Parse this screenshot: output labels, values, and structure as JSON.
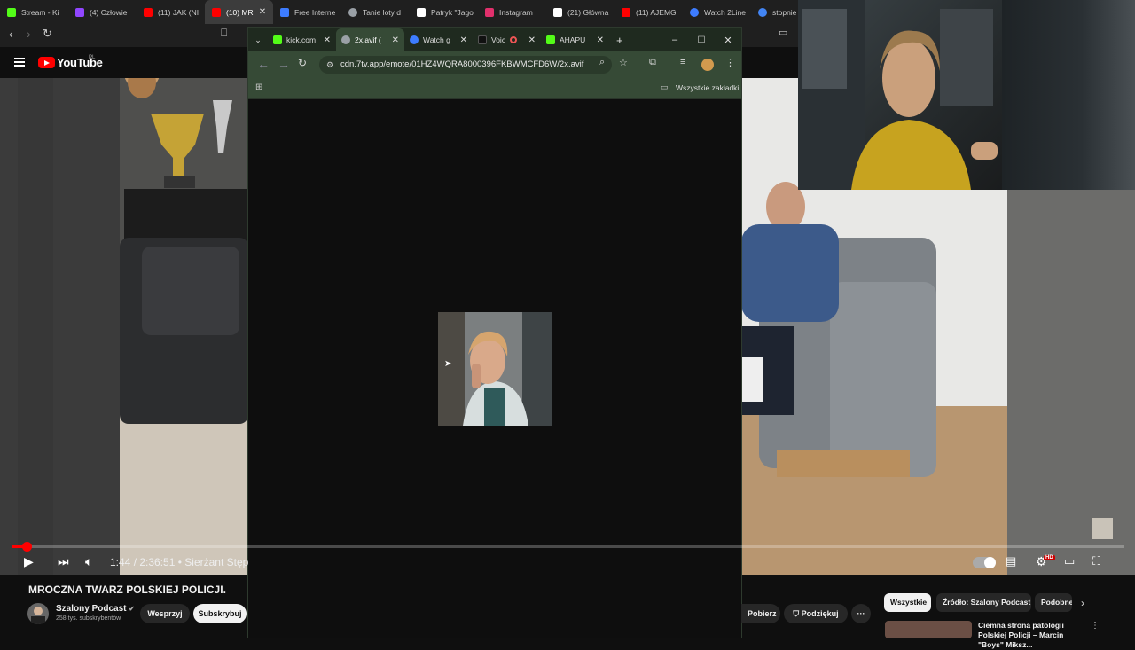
{
  "outer_tabs": [
    {
      "label": "Stream - Ki",
      "color": "#53fc18",
      "active": false
    },
    {
      "label": "(4) Człowie",
      "color": "#9146ff",
      "active": false
    },
    {
      "label": "(11) JAK (NI",
      "color": "#ff0000",
      "active": false
    },
    {
      "label": "(10) MR",
      "color": "#ff0000",
      "active": true
    },
    {
      "label": "Free Interne",
      "color": "#3d7cff",
      "active": false
    },
    {
      "label": "Tanie loty d",
      "color": "#9aa0a6",
      "active": false
    },
    {
      "label": "Patryk \"Jago",
      "color": "#ffffff",
      "active": false
    },
    {
      "label": "Instagram",
      "color": "#e1306c",
      "active": false
    },
    {
      "label": "(21) Główna",
      "color": "#ffffff",
      "active": false
    },
    {
      "label": "(11) AJEMG",
      "color": "#ff0000",
      "active": false
    },
    {
      "label": "Watch 2Line",
      "color": "#3d7cff",
      "active": false
    },
    {
      "label": "stopnie w",
      "color": "#4285f4",
      "active": false
    }
  ],
  "youtube": {
    "logo_text": "YouTube",
    "country_code": "PL"
  },
  "popup": {
    "tabs": [
      {
        "label": "kick.com",
        "color": "#53fc18",
        "active": false
      },
      {
        "label": "2x.avif (",
        "color": "#9aa0a6",
        "active": true
      },
      {
        "label": "Watch g",
        "color": "#3d7cff",
        "active": false
      },
      {
        "label": "Voic",
        "color": "#111111",
        "active": false
      },
      {
        "label": "AHAPU",
        "color": "#53fc18",
        "active": false
      }
    ],
    "new_tab_glyph": "+",
    "url": "cdn.7tv.app/emote/01HZ4WQRA8000396FKBWMCFD6W/2x.avif",
    "bookmarks_label": "Wszystkie zakładki"
  },
  "player": {
    "time": "1:44 / 2:36:51",
    "chapter": "• Sierżant Stęp",
    "hd_badge": "HD",
    "progress_fraction": 0.013
  },
  "video": {
    "title": "MROCZNA TWARZ POLSKIEJ POLICJI.",
    "channel": "Szalony Podcast",
    "subscribers": "258 tys. subskrybentów",
    "support_label": "Wesprzyj",
    "subscribe_label": "Subskrybuj",
    "download_label": "Pobierz",
    "thanks_label": "Podziękuj",
    "more_label": "···"
  },
  "recommendations": {
    "chips": [
      "Wszystkie",
      "Źródło: Szalony Podcast",
      "Podobne"
    ],
    "first_title": "Ciemna strona patologii Polskiej Policji – Marcin \"Boys\" Miksz..."
  },
  "colors": {
    "yt_red": "#ff0000",
    "popup_theme": "#364a36",
    "kick_green": "#53fc18"
  }
}
